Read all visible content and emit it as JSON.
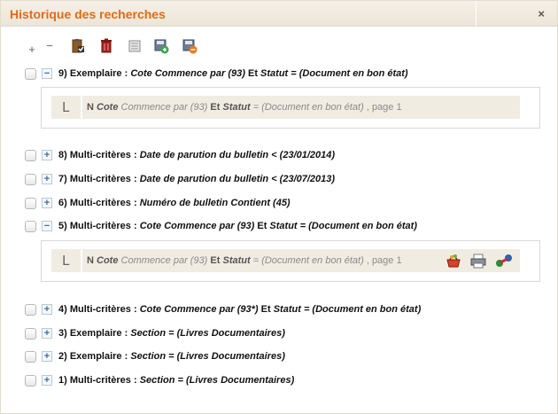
{
  "window": {
    "title": "Historique des recherches",
    "close_glyph": "×"
  },
  "toolbar": {
    "icons": [
      "expand-all-icon",
      "collapse-all-icon",
      "clipboard-check-icon",
      "delete-icon",
      "print-icon",
      "save-green-icon",
      "save-orange-icon"
    ],
    "expand_glyph": "+",
    "collapse_glyph": "−"
  },
  "colors": {
    "title": "#e36a10",
    "detail_bg": "#f1ece2",
    "toggle_blue": "#3a6ea5"
  },
  "searches": [
    {
      "num": "9)",
      "type": "Exemplaire :",
      "c1": "Cote Commence par (93)",
      "joiner": "Et",
      "c2a": "Statut",
      "c2b": "= (Document en bon état)",
      "toggle": "−",
      "expanded": true,
      "detail": {
        "prefix": "N",
        "field1": "Cote",
        "op1": "Commence par (93)",
        "joiner": "Et",
        "field2": "Statut",
        "op2": "= (Document en bon état)",
        "page": ", page 1"
      }
    },
    {
      "num": "8)",
      "type": "Multi-critères :",
      "c1": "Date de parution du bulletin < (23/01/2014)",
      "toggle": "+"
    },
    {
      "num": "7)",
      "type": "Multi-critères :",
      "c1": "Date de parution du bulletin < (23/07/2013)",
      "toggle": "+"
    },
    {
      "num": "6)",
      "type": "Multi-critères :",
      "c1": "Numéro de bulletin Contient (45)",
      "toggle": "+"
    },
    {
      "num": "5)",
      "type": "Multi-critères :",
      "c1": "Cote Commence par (93)",
      "joiner": "Et",
      "c2a": "Statut",
      "c2b": "= (Document en bon état)",
      "toggle": "−",
      "expanded": true,
      "detail": {
        "prefix": "N",
        "field1": "Cote",
        "op1": "Commence par (93)",
        "joiner": "Et",
        "field2": "Statut",
        "op2": "= (Document en bon état)",
        "page": ", page 1",
        "actions": [
          "basket-icon",
          "printer-icon",
          "export-link-icon"
        ]
      }
    },
    {
      "num": "4)",
      "type": "Multi-critères :",
      "c1": "Cote Commence par (93*)",
      "joiner": "Et",
      "c2a": "Statut",
      "c2b": "= (Document en bon état)",
      "toggle": "+"
    },
    {
      "num": "3)",
      "type": "Exemplaire :",
      "c1": "Section = (Livres Documentaires)",
      "toggle": "+"
    },
    {
      "num": "2)",
      "type": "Exemplaire :",
      "c1": "Section = (Livres Documentaires)",
      "toggle": "+"
    },
    {
      "num": "1)",
      "type": "Multi-critères :",
      "c1": "Section = (Livres Documentaires)",
      "toggle": "+"
    }
  ]
}
